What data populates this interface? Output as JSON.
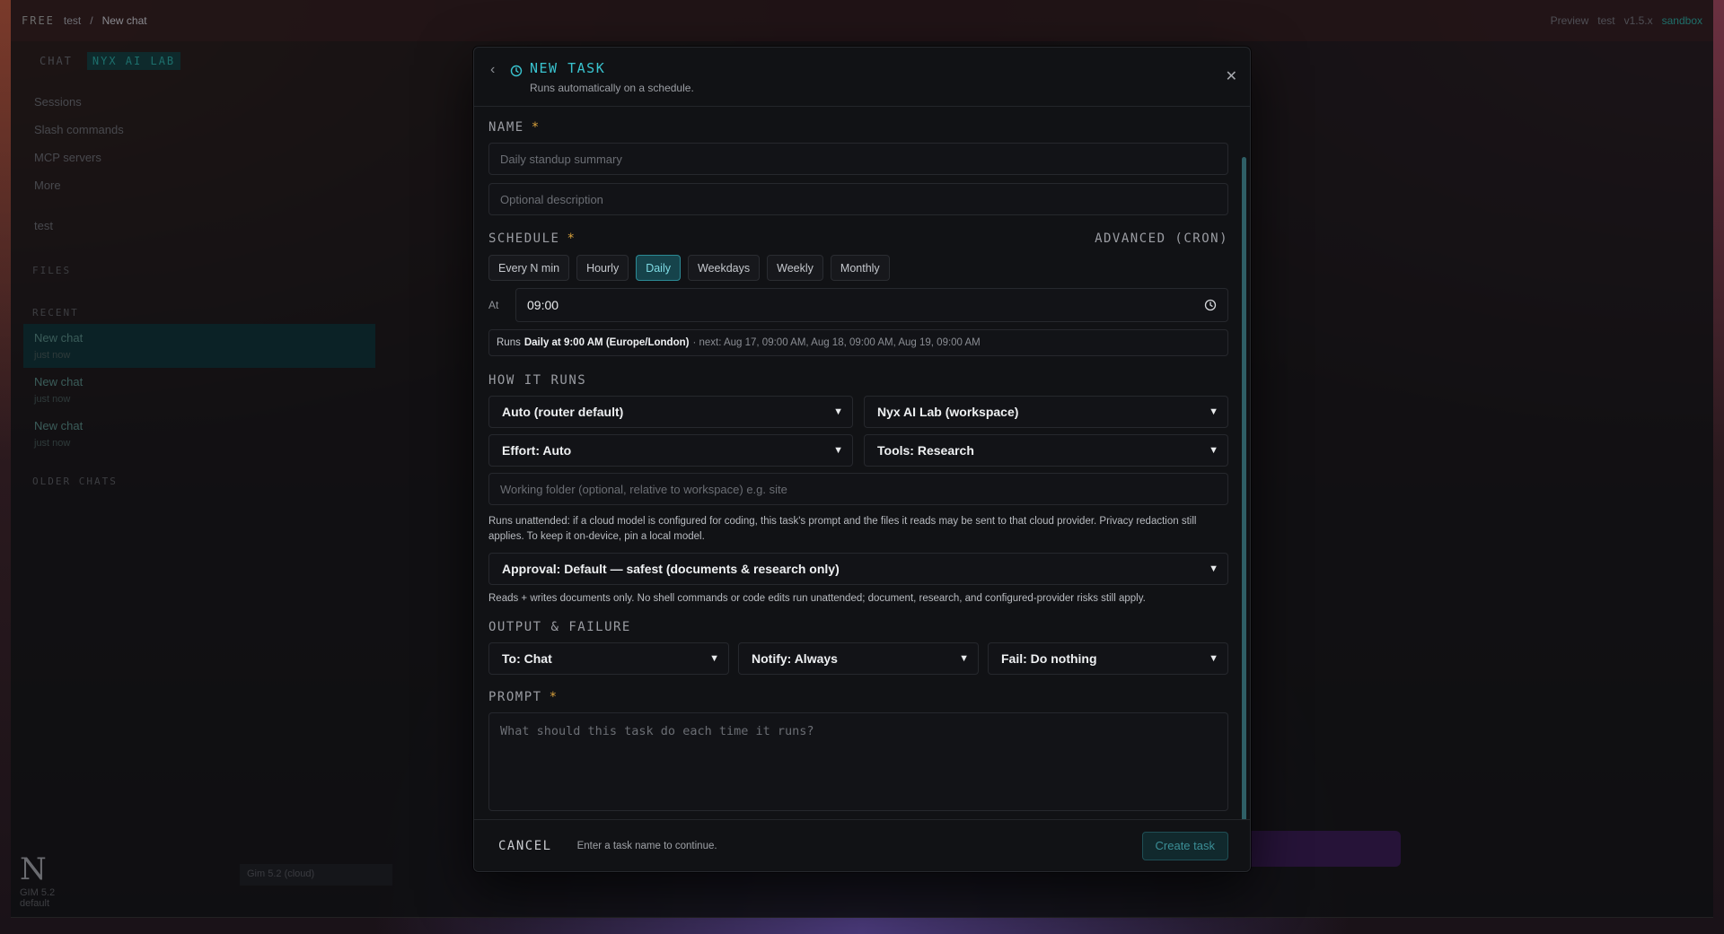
{
  "background": {
    "brand": "FREE",
    "crumb": "test",
    "crumb_current": "New chat",
    "tb_preview": "Preview",
    "tb_test": "test",
    "tb_version": "v1.5.x",
    "tb_sandbox": "sandbox",
    "side_tab_chat": "CHAT",
    "side_tab_lab": "NYX AI LAB",
    "side_items": [
      "Sessions",
      "Slash commands",
      "MCP servers",
      "More"
    ],
    "project_name": "test",
    "project_sub": "test",
    "files_label": "FILES",
    "recent_label": "RECENT",
    "chats": [
      {
        "title": "New chat",
        "sub": "just now"
      },
      {
        "title": "New chat",
        "sub": "just now"
      },
      {
        "title": "New chat",
        "sub": "just now"
      }
    ],
    "older_label": "OLDER CHATS",
    "logo": "N",
    "model_name": "GIM 5.2",
    "model_sub": "default",
    "model_pill": "Gim 5.2 (cloud)"
  },
  "modal": {
    "title": "NEW TASK",
    "subtitle": "Runs automatically on a schedule.",
    "name_label": "NAME",
    "required_mark": "*",
    "name_placeholder": "Daily standup summary",
    "description_placeholder": "Optional description",
    "schedule_label": "SCHEDULE",
    "advanced_link": "ADVANCED (CRON)",
    "schedule_options": [
      "Every N min",
      "Hourly",
      "Daily",
      "Weekdays",
      "Weekly",
      "Monthly"
    ],
    "schedule_selected": "Daily",
    "at_label": "At",
    "time_value": "09:00",
    "summary_prefix": "Runs",
    "summary_bold": "Daily at 9:00 AM (Europe/London)",
    "summary_next": "· next: Aug 17, 09:00 AM, Aug 18, 09:00 AM, Aug 19, 09:00 AM",
    "how_label": "HOW IT RUNS",
    "model_select": "Auto (router default)",
    "workspace_select": "Nyx AI Lab (workspace)",
    "effort_select": "Effort: Auto",
    "tools_select": "Tools: Research",
    "folder_placeholder": "Working folder (optional, relative to workspace) e.g. site",
    "privacy_note": "Runs unattended: if a cloud model is configured for coding, this task's prompt and the files it reads may be sent to that cloud provider. Privacy redaction still applies. To keep it on-device, pin a local model.",
    "approval_select": "Approval: Default — safest (documents & research only)",
    "approval_note": "Reads + writes documents only. No shell commands or code edits run unattended; document, research, and configured-provider risks still apply.",
    "output_label": "OUTPUT & FAILURE",
    "output_select": "To: Chat",
    "notify_select": "Notify: Always",
    "fail_select": "Fail: Do nothing",
    "prompt_label": "PROMPT",
    "prompt_placeholder": "What should this task do each time it runs?",
    "cancel_label": "CANCEL",
    "footer_hint": "Enter a task name to continue.",
    "create_label": "Create task"
  },
  "colors": {
    "accent": "#39c3cf",
    "required": "#d9a23c",
    "chip_active_bg": "#16434b"
  }
}
